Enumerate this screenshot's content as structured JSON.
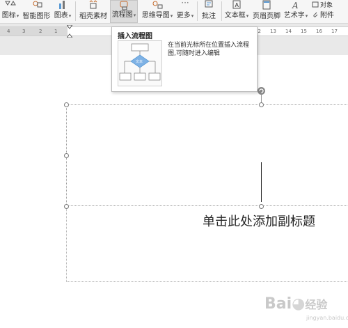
{
  "ribbon": {
    "items": [
      {
        "label": "图标",
        "caret": "▾"
      },
      {
        "label": "智能图形"
      },
      {
        "label": "图表",
        "caret": "▾"
      },
      {
        "label": "稻壳素材"
      },
      {
        "label": "流程图",
        "caret": "▾"
      },
      {
        "label": "思维导图",
        "caret": "▾"
      },
      {
        "label": "更多",
        "caret": "▾"
      },
      {
        "label": "批注"
      },
      {
        "label": "文本框",
        "caret": "▾"
      },
      {
        "label": "页眉页脚"
      },
      {
        "label": "艺术字",
        "caret": "▾"
      },
      {
        "label": "附件"
      },
      {
        "label": "对象"
      }
    ],
    "more_dots": "···"
  },
  "ruler": {
    "numbers_left": [
      "4",
      "3",
      "2",
      "1"
    ],
    "numbers_right": [
      "12",
      "13",
      "14",
      "15",
      "16",
      "17"
    ]
  },
  "tooltip": {
    "title": "插入流程图",
    "description": "在当前光标所在位置插入流程图,可随时进入编辑",
    "thumb_label": "文本"
  },
  "document": {
    "subtitle_placeholder": "单击此处添加副标题"
  },
  "watermark": {
    "brand": "Bai",
    "brand_cn": "经验",
    "sub": "jingyan.baidu.com"
  },
  "colors": {
    "accent": "#5b9bd5",
    "ribbon_bg": "#f6f6f6",
    "page_bg": "#ffffff",
    "tooltip_border": "#b8b8b8"
  }
}
